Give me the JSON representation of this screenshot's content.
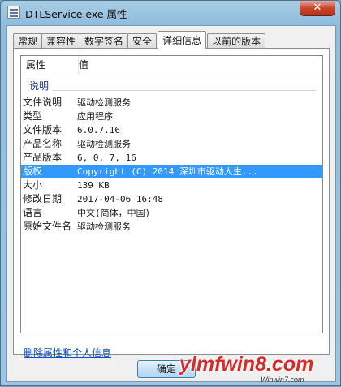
{
  "window": {
    "title": "DTLService.exe 属性",
    "close_glyph": "✕"
  },
  "tabs": [
    {
      "label": "常规",
      "active": false
    },
    {
      "label": "兼容性",
      "active": false
    },
    {
      "label": "数字签名",
      "active": false
    },
    {
      "label": "安全",
      "active": false
    },
    {
      "label": "详细信息",
      "active": true
    },
    {
      "label": "以前的版本",
      "active": false
    }
  ],
  "listview": {
    "columns": [
      "属性",
      "值"
    ],
    "group_label": "说明",
    "rows": [
      {
        "key": "文件说明",
        "value": "驱动检测服务"
      },
      {
        "key": "类型",
        "value": "应用程序"
      },
      {
        "key": "文件版本",
        "value": "6.0.7.16"
      },
      {
        "key": "产品名称",
        "value": "驱动检测服务"
      },
      {
        "key": "产品版本",
        "value": "6, 0, 7, 16"
      },
      {
        "key": "版权",
        "value": "Copyright (C) 2014 深圳市驱动人生...",
        "selected": true
      },
      {
        "key": "大小",
        "value": "139 KB"
      },
      {
        "key": "修改日期",
        "value": "2017-04-06 16:48"
      },
      {
        "key": "语言",
        "value": "中文(简体，中国)"
      },
      {
        "key": "原始文件名",
        "value": "驱动检测服务"
      }
    ]
  },
  "link_text": "删除属性和个人信息",
  "ok_label": "确定",
  "watermark": {
    "text": "ylmfwin8.com",
    "sub": "Winwin7.com"
  }
}
